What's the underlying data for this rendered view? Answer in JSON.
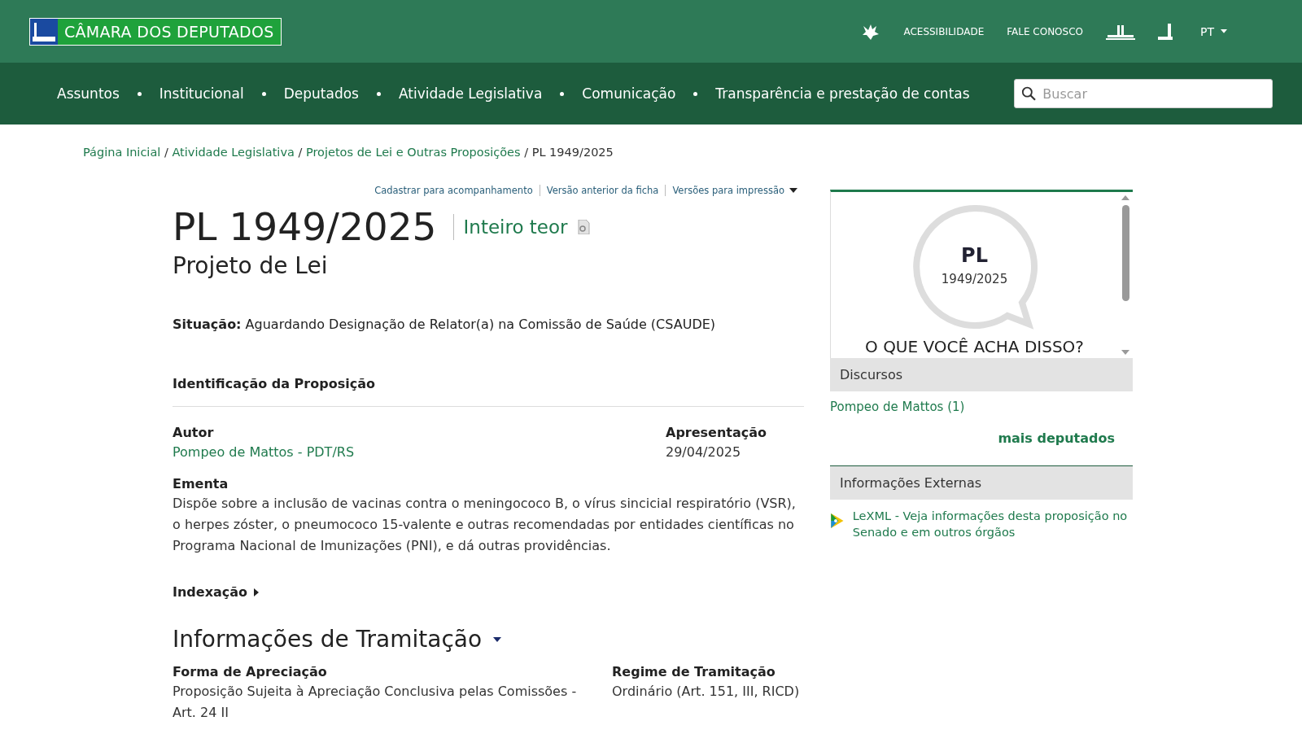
{
  "header": {
    "logo": "CÂMARA DOS DEPUTADOS",
    "links": [
      "ACESSIBILIDADE",
      "FALE CONOSCO"
    ],
    "language": "PT"
  },
  "nav": {
    "items": [
      "Assuntos",
      "Institucional",
      "Deputados",
      "Atividade Legislativa",
      "Comunicação",
      "Transparência e prestação de contas"
    ],
    "search": {
      "placeholder": "Buscar"
    }
  },
  "breadcrumb_separator": "/",
  "breadcrumb": [
    {
      "label": "Página Inicial",
      "link": true
    },
    {
      "label": "Atividade Legislativa",
      "link": true
    },
    {
      "label": "Projetos de Lei e Outras Proposições",
      "link": true
    },
    {
      "label": "PL 1949/2025",
      "link": false
    }
  ],
  "actions": [
    "Cadastrar para acompanhamento",
    "Versão anterior da ficha",
    "Versões para impressão"
  ],
  "title": "PL 1949/2025",
  "full_text_link": "Inteiro teor",
  "subtitle": "Projeto de Lei",
  "situation": {
    "label": "Situação:",
    "value": "Aguardando Designação de Relator(a) na Comissão de Saúde (CSAUDE)"
  },
  "identification": {
    "heading": "Identificação da Proposição",
    "author": {
      "label": "Autor",
      "value": "Pompeo de Mattos - PDT/RS"
    },
    "presentation": {
      "label": "Apresentação",
      "value": "29/04/2025"
    },
    "summary": {
      "label": "Ementa",
      "value": "Dispõe sobre a inclusão de vacinas contra o meningococo B, o vírus sincicial respiratório (VSR), o herpes zóster, o pneumococo 15-valente e outras recomendadas por entidades científicas no Programa Nacional de Imunizações (PNI), e dá outras providências."
    },
    "indexing": {
      "label": "Indexação",
      "expanded": false
    }
  },
  "procedure": {
    "heading": "Informações de Tramitação",
    "expanded": true,
    "fields": [
      {
        "label": "Forma de Apreciação",
        "value": "Proposição Sujeita à Apreciação Conclusiva pelas Comissões - Art. 24 II"
      },
      {
        "label": "Regime de Tramitação",
        "value": "Ordinário (Art. 151, III, RICD)"
      }
    ]
  },
  "sidebar": {
    "bubble": {
      "type": "PL",
      "number": "1949/2025",
      "question": "O QUE VOCÊ ACHA DISSO?"
    },
    "speeches": {
      "heading": "Discursos",
      "items": [
        "Pompeo de Mattos (1)"
      ],
      "more": "mais deputados"
    },
    "external": {
      "heading": "Informações Externas",
      "link": "LeXML - Veja informações desta proposição no Senado e em outros órgãos"
    }
  }
}
